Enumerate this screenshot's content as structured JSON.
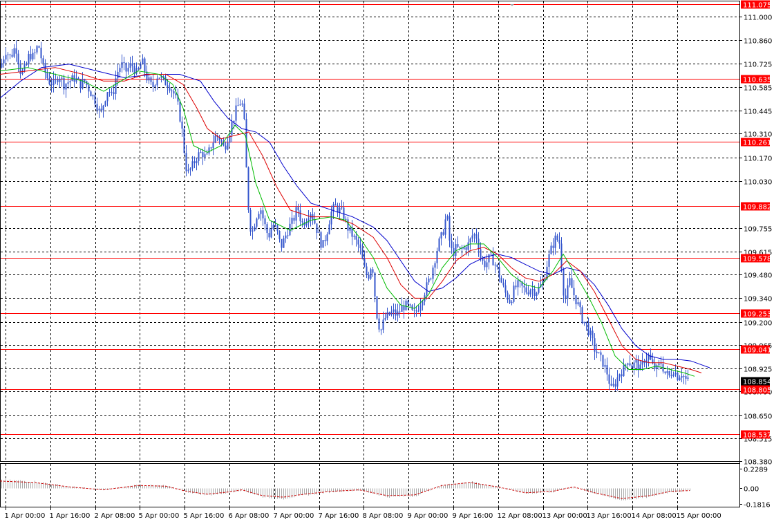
{
  "colors": {
    "background": "#ffffff",
    "grid": "#000000",
    "candle": "#3355cc",
    "ma_fast": "#00bb00",
    "ma_mid": "#dd0000",
    "ma_slow": "#0000cc",
    "level": "#ff0000",
    "current_price_box": "#000000",
    "oscillator_line": "#cc0000",
    "oscillator_hist": "#aaaaaa"
  },
  "price_axis": {
    "labels": [
      "111.000",
      "110.860",
      "110.725",
      "110.585",
      "110.445",
      "110.310",
      "110.170",
      "110.030",
      "109.755",
      "109.615",
      "109.480",
      "109.340",
      "109.200",
      "109.065",
      "108.925",
      "108.790",
      "108.650",
      "108.515",
      "108.380"
    ],
    "min": 108.38,
    "max": 111.09
  },
  "levels": [
    {
      "name": "level-111-075",
      "value": 111.075,
      "label": "111.075"
    },
    {
      "name": "level-110-635",
      "value": 110.635,
      "label": "110.635"
    },
    {
      "name": "level-110-261",
      "value": 110.261,
      "label": "110.261"
    },
    {
      "name": "level-109-882",
      "value": 109.882,
      "label": "109.882"
    },
    {
      "name": "level-109-578",
      "value": 109.578,
      "label": "109.578"
    },
    {
      "name": "level-109-253",
      "value": 109.253,
      "label": "109.253"
    },
    {
      "name": "level-109-041",
      "value": 109.041,
      "label": "109.041"
    },
    {
      "name": "level-108-805",
      "value": 108.805,
      "label": "108.805"
    },
    {
      "name": "level-108-537",
      "value": 108.537,
      "label": "108.537"
    }
  ],
  "current_price": {
    "value": 108.854,
    "label": "108.854"
  },
  "oscillator_axis": {
    "labels": [
      "0.2289",
      "0.00",
      "-0.1816"
    ],
    "values": [
      0.2289,
      0.0,
      -0.1816
    ]
  },
  "time_axis": {
    "labels": [
      "1 Apr 00:00",
      "1 Apr 16:00",
      "2 Apr 08:00",
      "5 Apr 00:00",
      "5 Apr 16:00",
      "6 Apr 08:00",
      "7 Apr 00:00",
      "7 Apr 16:00",
      "8 Apr 08:00",
      "9 Apr 00:00",
      "9 Apr 16:00",
      "12 Apr 08:00",
      "13 Apr 00:00",
      "13 Apr 16:00",
      "14 Apr 08:00",
      "15 Apr 00:00"
    ]
  },
  "chart_data": {
    "type": "candlestick",
    "symbol_timeframe": "",
    "price_path": [
      [
        0,
        110.7
      ],
      [
        8,
        110.8
      ],
      [
        15,
        110.76
      ],
      [
        22,
        110.83
      ],
      [
        30,
        110.66
      ],
      [
        37,
        110.7
      ],
      [
        42,
        110.78
      ],
      [
        48,
        110.76
      ],
      [
        55,
        110.84
      ],
      [
        62,
        110.7
      ],
      [
        70,
        110.62
      ],
      [
        78,
        110.6
      ],
      [
        85,
        110.66
      ],
      [
        92,
        110.6
      ],
      [
        100,
        110.62
      ],
      [
        108,
        110.64
      ],
      [
        115,
        110.6
      ],
      [
        122,
        110.62
      ],
      [
        130,
        110.56
      ],
      [
        138,
        110.5
      ],
      [
        145,
        110.42
      ],
      [
        150,
        110.5
      ],
      [
        156,
        110.58
      ],
      [
        162,
        110.52
      ],
      [
        168,
        110.66
      ],
      [
        175,
        110.72
      ],
      [
        182,
        110.68
      ],
      [
        190,
        110.72
      ],
      [
        198,
        110.66
      ],
      [
        205,
        110.74
      ],
      [
        212,
        110.64
      ],
      [
        220,
        110.58
      ],
      [
        228,
        110.66
      ],
      [
        236,
        110.62
      ],
      [
        244,
        110.6
      ],
      [
        252,
        110.54
      ],
      [
        258,
        110.46
      ],
      [
        264,
        110.3
      ],
      [
        268,
        110.12
      ],
      [
        272,
        110.08
      ],
      [
        278,
        110.12
      ],
      [
        285,
        110.18
      ],
      [
        292,
        110.2
      ],
      [
        298,
        110.16
      ],
      [
        305,
        110.24
      ],
      [
        312,
        110.3
      ],
      [
        318,
        110.28
      ],
      [
        324,
        110.22
      ],
      [
        330,
        110.3
      ],
      [
        336,
        110.38
      ],
      [
        342,
        110.46
      ],
      [
        348,
        110.5
      ],
      [
        352,
        110.46
      ],
      [
        356,
        110.1
      ],
      [
        360,
        109.8
      ],
      [
        364,
        109.72
      ],
      [
        370,
        109.82
      ],
      [
        376,
        109.88
      ],
      [
        382,
        109.78
      ],
      [
        388,
        109.7
      ],
      [
        394,
        109.78
      ],
      [
        400,
        109.74
      ],
      [
        406,
        109.64
      ],
      [
        412,
        109.7
      ],
      [
        418,
        109.76
      ],
      [
        424,
        109.8
      ],
      [
        430,
        109.88
      ],
      [
        436,
        109.78
      ],
      [
        442,
        109.8
      ],
      [
        448,
        109.86
      ],
      [
        454,
        109.8
      ],
      [
        460,
        109.72
      ],
      [
        466,
        109.64
      ],
      [
        472,
        109.72
      ],
      [
        478,
        109.84
      ],
      [
        484,
        109.88
      ],
      [
        490,
        109.86
      ],
      [
        496,
        109.84
      ],
      [
        502,
        109.76
      ],
      [
        508,
        109.72
      ],
      [
        514,
        109.68
      ],
      [
        520,
        109.64
      ],
      [
        526,
        109.52
      ],
      [
        532,
        109.46
      ],
      [
        538,
        109.56
      ],
      [
        544,
        109.26
      ],
      [
        550,
        109.14
      ],
      [
        556,
        109.22
      ],
      [
        562,
        109.24
      ],
      [
        568,
        109.26
      ],
      [
        574,
        109.24
      ],
      [
        580,
        109.28
      ],
      [
        586,
        109.3
      ],
      [
        592,
        109.28
      ],
      [
        598,
        109.24
      ],
      [
        604,
        109.28
      ],
      [
        610,
        109.34
      ],
      [
        616,
        109.4
      ],
      [
        622,
        109.46
      ],
      [
        628,
        109.56
      ],
      [
        634,
        109.66
      ],
      [
        640,
        109.72
      ],
      [
        646,
        109.84
      ],
      [
        650,
        109.68
      ],
      [
        654,
        109.6
      ],
      [
        660,
        109.64
      ],
      [
        666,
        109.62
      ],
      [
        672,
        109.64
      ],
      [
        678,
        109.66
      ],
      [
        684,
        109.72
      ],
      [
        690,
        109.7
      ],
      [
        696,
        109.56
      ],
      [
        702,
        109.54
      ],
      [
        708,
        109.58
      ],
      [
        714,
        109.56
      ],
      [
        720,
        109.5
      ],
      [
        726,
        109.42
      ],
      [
        732,
        109.36
      ],
      [
        738,
        109.32
      ],
      [
        744,
        109.4
      ],
      [
        750,
        109.42
      ],
      [
        756,
        109.4
      ],
      [
        762,
        109.38
      ],
      [
        768,
        109.4
      ],
      [
        774,
        109.38
      ],
      [
        780,
        109.4
      ],
      [
        786,
        109.44
      ],
      [
        792,
        109.56
      ],
      [
        798,
        109.64
      ],
      [
        804,
        109.7
      ],
      [
        810,
        109.66
      ],
      [
        814,
        109.4
      ],
      [
        818,
        109.34
      ],
      [
        824,
        109.44
      ],
      [
        830,
        109.36
      ],
      [
        836,
        109.3
      ],
      [
        842,
        109.22
      ],
      [
        848,
        109.18
      ],
      [
        854,
        109.12
      ],
      [
        860,
        109.04
      ],
      [
        866,
        109.0
      ],
      [
        872,
        108.96
      ],
      [
        878,
        108.9
      ],
      [
        884,
        108.8
      ],
      [
        890,
        108.84
      ],
      [
        896,
        108.9
      ],
      [
        902,
        108.92
      ],
      [
        908,
        108.98
      ],
      [
        914,
        108.94
      ],
      [
        920,
        108.96
      ],
      [
        926,
        108.92
      ],
      [
        932,
        108.98
      ],
      [
        938,
        109.0
      ],
      [
        944,
        108.94
      ],
      [
        950,
        108.92
      ],
      [
        956,
        108.96
      ],
      [
        962,
        108.9
      ],
      [
        968,
        108.88
      ],
      [
        974,
        108.92
      ],
      [
        980,
        108.88
      ],
      [
        986,
        108.9
      ],
      [
        992,
        108.86
      ],
      [
        996,
        108.85
      ]
    ],
    "ma_fast_path": [
      [
        0,
        110.68
      ],
      [
        40,
        110.7
      ],
      [
        80,
        110.66
      ],
      [
        120,
        110.62
      ],
      [
        150,
        110.56
      ],
      [
        175,
        110.62
      ],
      [
        200,
        110.68
      ],
      [
        230,
        110.66
      ],
      [
        250,
        110.6
      ],
      [
        265,
        110.46
      ],
      [
        280,
        110.24
      ],
      [
        300,
        110.2
      ],
      [
        320,
        110.24
      ],
      [
        340,
        110.36
      ],
      [
        355,
        110.3
      ],
      [
        370,
        110.02
      ],
      [
        390,
        109.8
      ],
      [
        420,
        109.74
      ],
      [
        450,
        109.8
      ],
      [
        480,
        109.82
      ],
      [
        500,
        109.8
      ],
      [
        520,
        109.7
      ],
      [
        540,
        109.58
      ],
      [
        560,
        109.4
      ],
      [
        580,
        109.3
      ],
      [
        600,
        109.28
      ],
      [
        620,
        109.36
      ],
      [
        640,
        109.52
      ],
      [
        660,
        109.62
      ],
      [
        680,
        109.66
      ],
      [
        700,
        109.66
      ],
      [
        720,
        109.58
      ],
      [
        740,
        109.48
      ],
      [
        760,
        109.42
      ],
      [
        780,
        109.4
      ],
      [
        800,
        109.5
      ],
      [
        815,
        109.6
      ],
      [
        830,
        109.5
      ],
      [
        850,
        109.36
      ],
      [
        870,
        109.2
      ],
      [
        890,
        109.0
      ],
      [
        910,
        108.92
      ],
      [
        930,
        108.92
      ],
      [
        950,
        108.94
      ],
      [
        970,
        108.92
      ],
      [
        990,
        108.9
      ],
      [
        1005,
        108.88
      ]
    ],
    "ma_mid_path": [
      [
        0,
        110.66
      ],
      [
        40,
        110.68
      ],
      [
        80,
        110.7
      ],
      [
        120,
        110.66
      ],
      [
        150,
        110.62
      ],
      [
        180,
        110.62
      ],
      [
        210,
        110.66
      ],
      [
        240,
        110.66
      ],
      [
        265,
        110.6
      ],
      [
        285,
        110.46
      ],
      [
        300,
        110.34
      ],
      [
        320,
        110.28
      ],
      [
        340,
        110.3
      ],
      [
        360,
        110.32
      ],
      [
        380,
        110.18
      ],
      [
        400,
        110.0
      ],
      [
        420,
        109.86
      ],
      [
        450,
        109.82
      ],
      [
        480,
        109.82
      ],
      [
        510,
        109.78
      ],
      [
        540,
        109.7
      ],
      [
        560,
        109.58
      ],
      [
        580,
        109.42
      ],
      [
        600,
        109.34
      ],
      [
        620,
        109.34
      ],
      [
        640,
        109.44
      ],
      [
        660,
        109.56
      ],
      [
        680,
        109.62
      ],
      [
        700,
        109.64
      ],
      [
        720,
        109.6
      ],
      [
        740,
        109.52
      ],
      [
        760,
        109.46
      ],
      [
        780,
        109.44
      ],
      [
        800,
        109.48
      ],
      [
        820,
        109.56
      ],
      [
        840,
        109.5
      ],
      [
        860,
        109.38
      ],
      [
        880,
        109.22
      ],
      [
        900,
        109.06
      ],
      [
        920,
        108.98
      ],
      [
        940,
        108.96
      ],
      [
        960,
        108.96
      ],
      [
        980,
        108.94
      ],
      [
        1000,
        108.92
      ],
      [
        1015,
        108.9
      ]
    ],
    "ma_slow_path": [
      [
        0,
        110.52
      ],
      [
        30,
        110.62
      ],
      [
        60,
        110.7
      ],
      [
        100,
        110.72
      ],
      [
        140,
        110.68
      ],
      [
        180,
        110.64
      ],
      [
        220,
        110.66
      ],
      [
        260,
        110.66
      ],
      [
        290,
        110.62
      ],
      [
        310,
        110.5
      ],
      [
        330,
        110.4
      ],
      [
        350,
        110.34
      ],
      [
        370,
        110.32
      ],
      [
        390,
        110.26
      ],
      [
        410,
        110.12
      ],
      [
        430,
        110.0
      ],
      [
        450,
        109.9
      ],
      [
        480,
        109.86
      ],
      [
        510,
        109.82
      ],
      [
        540,
        109.76
      ],
      [
        560,
        109.68
      ],
      [
        580,
        109.56
      ],
      [
        600,
        109.44
      ],
      [
        620,
        109.38
      ],
      [
        640,
        109.4
      ],
      [
        660,
        109.46
      ],
      [
        680,
        109.54
      ],
      [
        700,
        109.58
      ],
      [
        720,
        109.6
      ],
      [
        740,
        109.58
      ],
      [
        760,
        109.54
      ],
      [
        780,
        109.5
      ],
      [
        800,
        109.48
      ],
      [
        820,
        109.52
      ],
      [
        840,
        109.5
      ],
      [
        860,
        109.42
      ],
      [
        880,
        109.3
      ],
      [
        900,
        109.16
      ],
      [
        920,
        109.06
      ],
      [
        940,
        109.0
      ],
      [
        960,
        108.98
      ],
      [
        980,
        108.98
      ],
      [
        1000,
        108.97
      ],
      [
        1027,
        108.93
      ]
    ],
    "oscillator_path": [
      [
        0,
        0.1
      ],
      [
        50,
        0.08
      ],
      [
        100,
        0.02
      ],
      [
        150,
        -0.02
      ],
      [
        200,
        0.04
      ],
      [
        240,
        0.03
      ],
      [
        270,
        -0.04
      ],
      [
        300,
        -0.08
      ],
      [
        330,
        -0.05
      ],
      [
        350,
        -0.02
      ],
      [
        380,
        -0.1
      ],
      [
        410,
        -0.12
      ],
      [
        440,
        -0.08
      ],
      [
        480,
        -0.04
      ],
      [
        520,
        -0.02
      ],
      [
        560,
        -0.1
      ],
      [
        600,
        -0.09
      ],
      [
        640,
        0.04
      ],
      [
        680,
        0.08
      ],
      [
        720,
        0.02
      ],
      [
        760,
        -0.06
      ],
      [
        800,
        -0.04
      ],
      [
        830,
        0.02
      ],
      [
        860,
        -0.06
      ],
      [
        900,
        -0.14
      ],
      [
        940,
        -0.1
      ],
      [
        970,
        -0.04
      ],
      [
        998,
        -0.03
      ]
    ]
  }
}
